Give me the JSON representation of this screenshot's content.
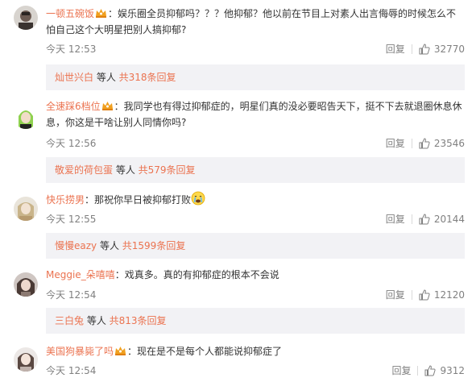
{
  "comments": [
    {
      "user": "一顿五碗饭",
      "text_line1": "娱乐圈全员抑郁吗？？？他抑郁？他以前在节目上对素人出言侮辱的时候怎么不",
      "text_line2": "怕自己这个大明星把别人搞抑郁?",
      "date": "今天",
      "time": "12:53",
      "reply_label": "回复",
      "likes": "32770",
      "reply_user": "灿世兴白",
      "reply_mid": " 等人 ",
      "reply_count": "共318条回复"
    },
    {
      "user": "全速踩6档位",
      "text_line1": "我同学也有得过抑郁症的，明星们真的没必要昭告天下，挺不下去就退圈休息休",
      "text_line2": "息，你这是干啥让别人同情你吗?",
      "date": "今天",
      "time": "12:56",
      "reply_label": "回复",
      "likes": "23546",
      "reply_user": "敬爱的荷包蛋",
      "reply_mid": " 等人 ",
      "reply_count": "共579条回复"
    },
    {
      "user": "快乐捞男",
      "text_line1": "那祝你早日被抑郁打败",
      "date": "今天",
      "time": "12:55",
      "reply_label": "回复",
      "likes": "20144",
      "reply_user": "慢慢eazy",
      "reply_mid": " 等人 ",
      "reply_count": "共1599条回复"
    },
    {
      "user": "Meggie_朵嘻嘻",
      "text_line1": "戏真多。真的有抑郁症的根本不会说",
      "date": "今天",
      "time": "12:54",
      "reply_label": "回复",
      "likes": "12120",
      "reply_user": "三白兔",
      "reply_mid": " 等人 ",
      "reply_count": "共813条回复"
    },
    {
      "user": "美国狗暴毙了吗",
      "text_line1": "现在是不是每个人都能说抑郁症了",
      "date": "今天",
      "time": "12:54",
      "reply_label": "回复",
      "likes": "9312"
    }
  ],
  "colors": {
    "username": "#eb7350",
    "meta": "#808080",
    "reply_box_bg": "#f2f2f5"
  },
  "icons": {
    "badge": "vip-crown-badge-icon",
    "like": "thumbs-up-icon",
    "emoji": "crying-face-emoji-icon"
  }
}
